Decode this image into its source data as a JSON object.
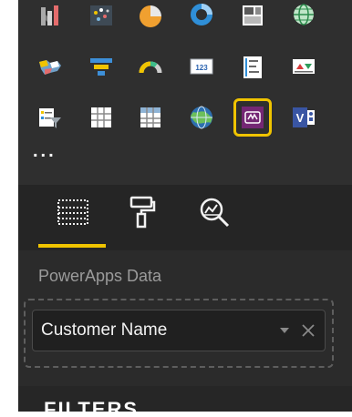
{
  "visualizations": {
    "more_label": "...",
    "selected_icon": "powerapps-visual-icon",
    "rows": [
      [
        "ribbon-chart-icon",
        "scatter-chart-icon",
        "pie-chart-icon",
        "donut-chart-icon",
        "treemap-icon",
        "map-icon"
      ],
      [
        "filled-map-icon",
        "funnel-chart-icon",
        "gauge-icon",
        "card-icon",
        "multi-row-card-icon",
        "kpi-icon"
      ],
      [
        "slicer-icon",
        "table-icon",
        "matrix-icon",
        "arcgis-map-icon",
        "powerapps-visual-icon",
        "visio-visual-icon"
      ]
    ],
    "card_text": "123",
    "visio_letter": "V"
  },
  "pane_tabs": {
    "active": "fields",
    "items": [
      {
        "name": "fields",
        "icon": "fields-icon"
      },
      {
        "name": "format",
        "icon": "paint-roller-icon"
      },
      {
        "name": "analytics",
        "icon": "analytics-magnifier-icon"
      }
    ]
  },
  "fields": {
    "section_label": "PowerApps Data",
    "field_value": "Customer Name"
  },
  "filters": {
    "title": "FILTERS"
  },
  "colors": {
    "accent": "#f0c400",
    "pane_background": "#2b2b2b",
    "powerapps_purple": "#742774",
    "visio_blue": "#3955a3"
  }
}
